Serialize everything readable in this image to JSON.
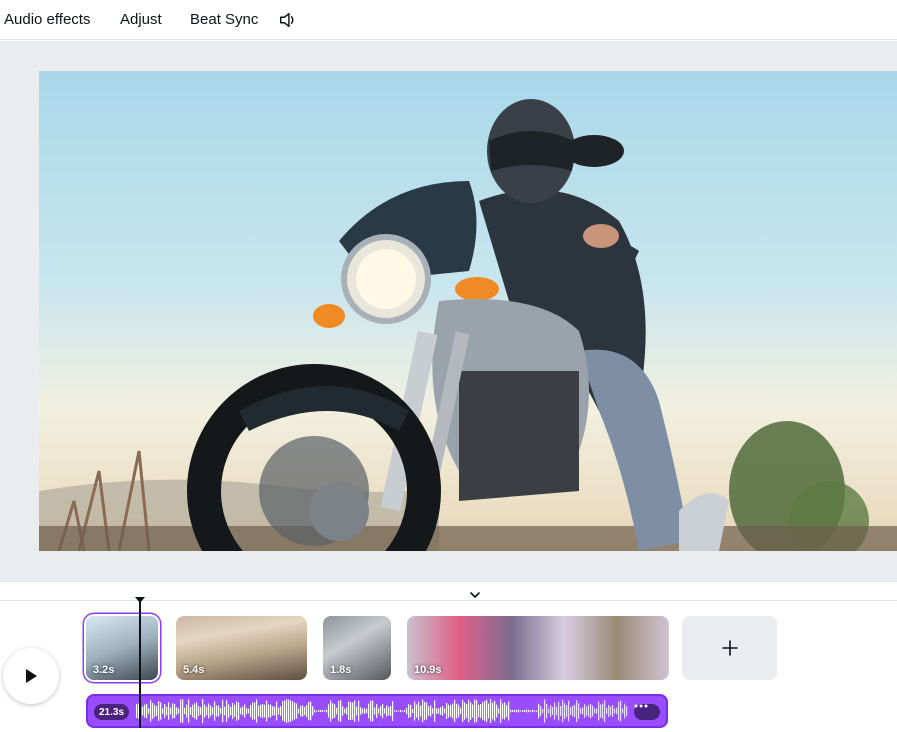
{
  "toolbar": {
    "audio_effects": "Audio effects",
    "adjust": "Adjust",
    "beat_sync": "Beat Sync",
    "volume_icon": "speaker-icon"
  },
  "timeline": {
    "clips": [
      {
        "duration": "3.2s",
        "selected": true
      },
      {
        "duration": "5.4s",
        "selected": false
      },
      {
        "duration": "1.8s",
        "selected": false
      },
      {
        "duration": "10.9s",
        "selected": false
      }
    ],
    "add_icon": "plus-icon",
    "audio": {
      "duration": "21.3s",
      "more_icon": "more-horizontal-icon"
    },
    "play_icon": "play-icon",
    "collapse_icon": "chevron-down-icon"
  },
  "colors": {
    "accent": "#8b3dff",
    "audio_track": "#9a4dff",
    "canvas_bg": "#ebecf0"
  }
}
